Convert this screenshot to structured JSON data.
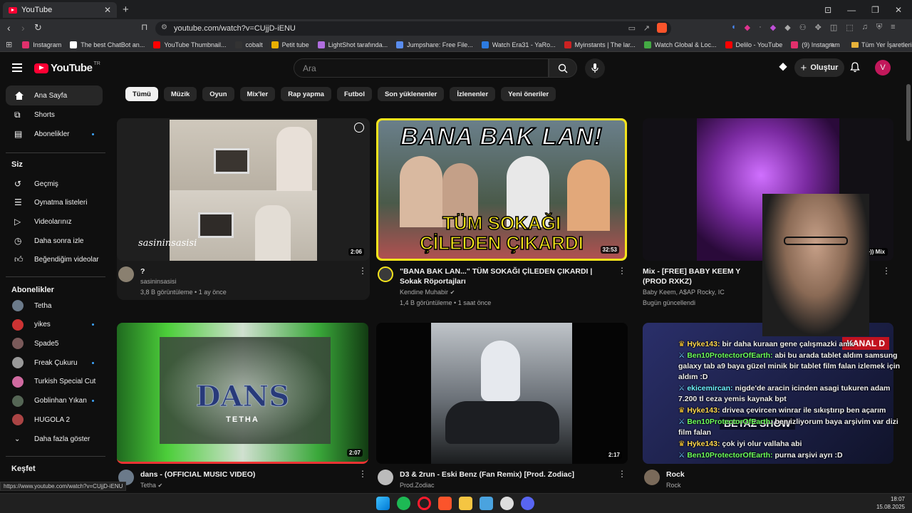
{
  "browser": {
    "tab_title": "YouTube",
    "url": "youtube.com/watch?v=CUjjD-iENU",
    "status_url": "https://www.youtube.com/watch?v=CUjjD-iENU",
    "bookmarks": [
      {
        "label": "Instagram",
        "color": "#e1306c"
      },
      {
        "label": "The best ChatBot an...",
        "color": "#ffffff"
      },
      {
        "label": "YouTube Thumbnail...",
        "color": "#ff0000"
      },
      {
        "label": "cobalt",
        "color": "#333333"
      },
      {
        "label": "Petit tube",
        "color": "#e9b000"
      },
      {
        "label": "LightShot tarafında...",
        "color": "#b16ee0"
      },
      {
        "label": "Jumpshare: Free File...",
        "color": "#5a8dee"
      },
      {
        "label": "Watch Era31 - YaRo...",
        "color": "#2d7be0"
      },
      {
        "label": "Myinstants | The lar...",
        "color": "#cc2222"
      },
      {
        "label": "Watch Global & Loc...",
        "color": "#44aa44"
      },
      {
        "label": "Delilo - YouTube",
        "color": "#ff0000"
      },
      {
        "label": "(9) Instagram",
        "color": "#e1306c"
      }
    ],
    "all_bookmarks": "Tüm Yer İşaretleri"
  },
  "header": {
    "logo_text": "YouTube",
    "logo_region": "TR",
    "search_placeholder": "Ara",
    "create_label": "Oluştur",
    "avatar_letter": "V"
  },
  "sidebar": {
    "main": [
      {
        "label": "Ana Sayfa",
        "active": true
      },
      {
        "label": "Shorts"
      },
      {
        "label": "Abonelikler",
        "dot": true
      }
    ],
    "you_heading": "Siz",
    "you": [
      "Geçmiş",
      "Oynatma listeleri",
      "Videolarınız",
      "Daha sonra izle",
      "Beğendiğim videolar"
    ],
    "subs_heading": "Abonelikler",
    "subs": [
      {
        "label": "Tetha",
        "dot": false,
        "color": "#6b7a8a"
      },
      {
        "label": "yikes",
        "dot": true,
        "color": "#cc3333"
      },
      {
        "label": "Spade5",
        "dot": false,
        "color": "#7a5a5a"
      },
      {
        "label": "Freak Çukuru",
        "dot": true,
        "color": "#999999"
      },
      {
        "label": "Turkish Special Cut",
        "dot": false,
        "color": "#d06aa0"
      },
      {
        "label": "Goblinhan Yıkan",
        "dot": true,
        "color": "#556655"
      },
      {
        "label": "HUGOLA 2",
        "dot": false,
        "color": "#aa4444"
      }
    ],
    "show_more": "Daha fazla göster",
    "explore_heading": "Keşfet"
  },
  "chips": [
    "Tümü",
    "Müzik",
    "Oyun",
    "Mix'ler",
    "Rap yapma",
    "Futbol",
    "Son yüklenenler",
    "İzlenenler",
    "Yeni öneriler"
  ],
  "videos": [
    {
      "title": "?",
      "channel": "sasininsasisi",
      "meta": "3,8 B görüntüleme • 1 ay önce",
      "duration": "2:06",
      "thumb_text": "sasininsasisi"
    },
    {
      "title": "\"BANA BAK LAN...\" TÜM SOKAĞI ÇİLEDEN ÇIKARDI | Sokak Röportajları",
      "channel": "Kendine Muhabir",
      "meta": "1,4 B görüntüleme • 1 saat önce",
      "duration": "32:53",
      "thumb_top": "BANA BAK LAN!",
      "thumb_bottom1": "TÜM SOKAĞI",
      "thumb_bottom2": "ÇİLEDEN ÇIKARDI"
    },
    {
      "title": "Mix - [FREE] BABY KEEM Y",
      "title2": "(PROD RXKZ)",
      "channel": "Baby Keem, A$AP Rocky, IC",
      "meta": "Bugün güncellendi",
      "badge": "Mix"
    },
    {
      "title": "dans - (OFFICIAL MUSIC VIDEO)",
      "channel": "Tetha",
      "duration": "2:07",
      "thumb_text": "DANS",
      "thumb_sub": "TETHA"
    },
    {
      "title": "D3 & 2run - Eski Benz (Fan Remix) [Prod. Zodiac]",
      "channel": "Prod.Zodiac",
      "duration": "2:17"
    },
    {
      "title": "Rock",
      "channel": "Rock"
    }
  ],
  "stream_overlay": {
    "banner": "KANAL D",
    "show": "BEYAZ SHOW",
    "messages": [
      {
        "user": "Hyke143:",
        "text": "bir daha kuraan gene çalışmazki amk",
        "cls": "u1"
      },
      {
        "user": "Ben10ProtectorOfEarth:",
        "text": "abi bu arada tablet aldım samsung galaxy tab a9 baya güzel minik bir tablet film falan izlemek için aldım :D",
        "cls": "u2"
      },
      {
        "user": "ekicemircan:",
        "text": "nigde'de aracin icinden asagi tukuren adam 7.200 tl ceza yemis kaynak bpt",
        "cls": "u3"
      },
      {
        "user": "Hyke143:",
        "text": "drivea çevircen winrar ile sıkıştırıp ben açarım",
        "cls": "u1"
      },
      {
        "user": "Ben10ProtectorOfEarth:",
        "text": "ben izliyorum baya arşivim var dizi film falan",
        "cls": "u2"
      },
      {
        "user": "Hyke143:",
        "text": "çok iyi olur vallaha abi",
        "cls": "u1"
      },
      {
        "user": "Ben10ProtectorOfEarth:",
        "text": "purna arşivi ayrı :D",
        "cls": "u2"
      }
    ]
  },
  "taskbar": {
    "time": "18:07",
    "date": "15.08.2025"
  }
}
